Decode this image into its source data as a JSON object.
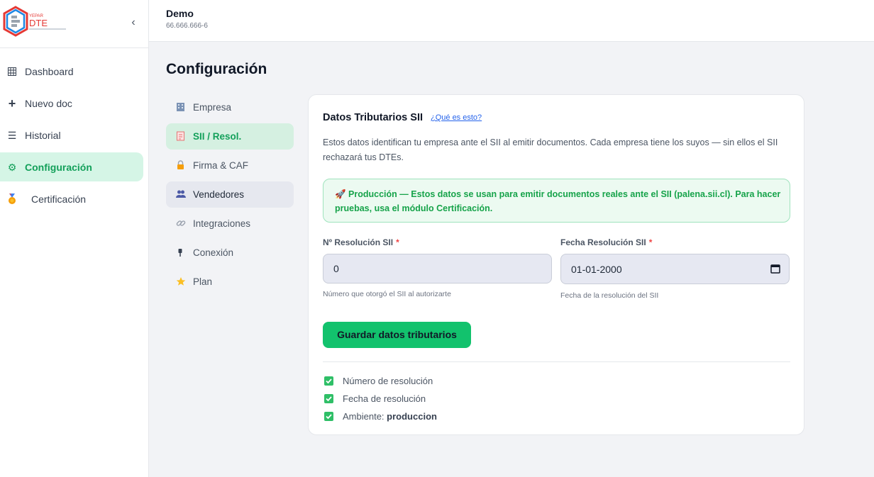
{
  "app": {
    "logo_text": "DTE",
    "logo_top_text": "YEPAR",
    "collapse_icon": "chevron-left-icon"
  },
  "sidebar": {
    "items": [
      {
        "label": "Dashboard",
        "icon": "grid-icon"
      },
      {
        "label": "Nuevo doc",
        "icon": "plus-icon"
      },
      {
        "label": "Historial",
        "icon": "list-icon"
      },
      {
        "label": "Configuración",
        "icon": "gear-icon",
        "active": true
      },
      {
        "label": "Certificación",
        "icon": "medal-icon"
      }
    ]
  },
  "header": {
    "company_name": "Demo",
    "company_rut": "66.666.666-6"
  },
  "page": {
    "title": "Configuración"
  },
  "submenu": {
    "items": [
      {
        "label": "Empresa",
        "icon": "building-icon"
      },
      {
        "label": "SII / Resol.",
        "icon": "document-icon",
        "active": true
      },
      {
        "label": "Firma & CAF",
        "icon": "lock-icon"
      },
      {
        "label": "Vendedores",
        "icon": "users-icon"
      },
      {
        "label": "Integraciones",
        "icon": "link-icon"
      },
      {
        "label": "Conexión",
        "icon": "plug-icon"
      },
      {
        "label": "Plan",
        "icon": "star-icon"
      }
    ]
  },
  "card": {
    "title": "Datos Tributarios SII",
    "help_link": "¿Qué es esto?",
    "description": "Estos datos identifican tu empresa ante el SII al emitir documentos. Cada empresa tiene los suyos — sin ellos el SII rechazará tus DTEs.",
    "alert": "🚀 Producción — Estos datos se usan para emitir documentos reales ante el SII (palena.sii.cl). Para hacer pruebas, usa el módulo Certificación.",
    "fields": {
      "resolution_number": {
        "label": "Nº Resolución SII",
        "required_mark": "*",
        "value": "0",
        "hint": "Número que otorgó el SII al autorizarte"
      },
      "resolution_date": {
        "label": "Fecha Resolución SII",
        "required_mark": "*",
        "value": "01-01-2000",
        "hint": "Fecha de la resolución del SII"
      }
    },
    "save_button": "Guardar datos tributarios",
    "checklist": [
      {
        "label": "Número de resolución",
        "checked": true
      },
      {
        "label": "Fecha de resolución",
        "checked": true
      },
      {
        "prefix": "Ambiente:",
        "value": "produccion",
        "checked": true
      }
    ]
  },
  "colors": {
    "accent": "#12c26d",
    "active_bg": "#d5f5e6",
    "active_text": "#13a05a",
    "alert_bg": "#ecfaf1",
    "link": "#2563eb"
  }
}
